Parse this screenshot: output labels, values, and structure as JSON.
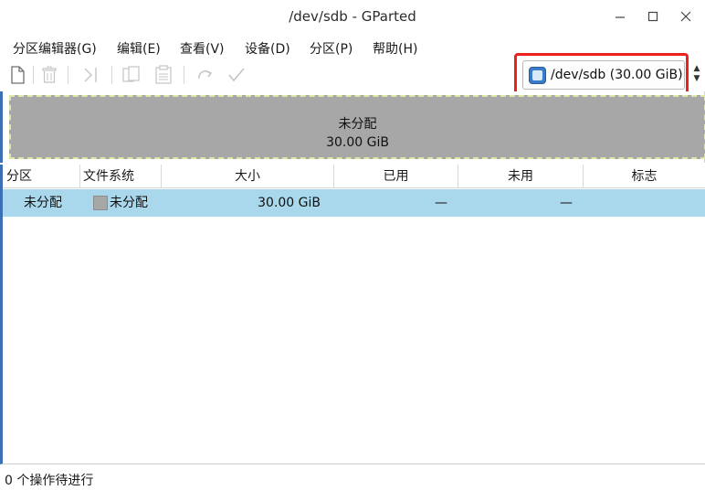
{
  "window": {
    "title": "/dev/sdb - GParted"
  },
  "menu": [
    {
      "label": "分区编辑器(G)"
    },
    {
      "label": "编辑(E)"
    },
    {
      "label": "查看(V)"
    },
    {
      "label": "设备(D)"
    },
    {
      "label": "分区(P)"
    },
    {
      "label": "帮助(H)"
    }
  ],
  "toolbar": {
    "icons": [
      "new-icon",
      "delete-icon",
      "resize-move-icon",
      "copy-icon",
      "paste-icon",
      "undo-icon",
      "apply-icon"
    ]
  },
  "device_selector": {
    "label": "/dev/sdb   (30.00 GiB)",
    "icon": "disk-icon"
  },
  "graph": {
    "label": "未分配",
    "size": "30.00 GiB",
    "color": "#a7a7a7"
  },
  "table": {
    "columns": [
      "分区",
      "文件系统",
      "大小",
      "已用",
      "未用",
      "标志"
    ],
    "rows": [
      {
        "partition": "未分配",
        "filesystem": "未分配",
        "size": "30.00 GiB",
        "used": "—",
        "unused": "—",
        "flags": ""
      }
    ]
  },
  "status": {
    "text": "0 个操作待进行"
  },
  "colors": {
    "selection": "#a9d8ec",
    "highlight": "#ee1f1f",
    "unallocated": "#a7a7a7"
  }
}
